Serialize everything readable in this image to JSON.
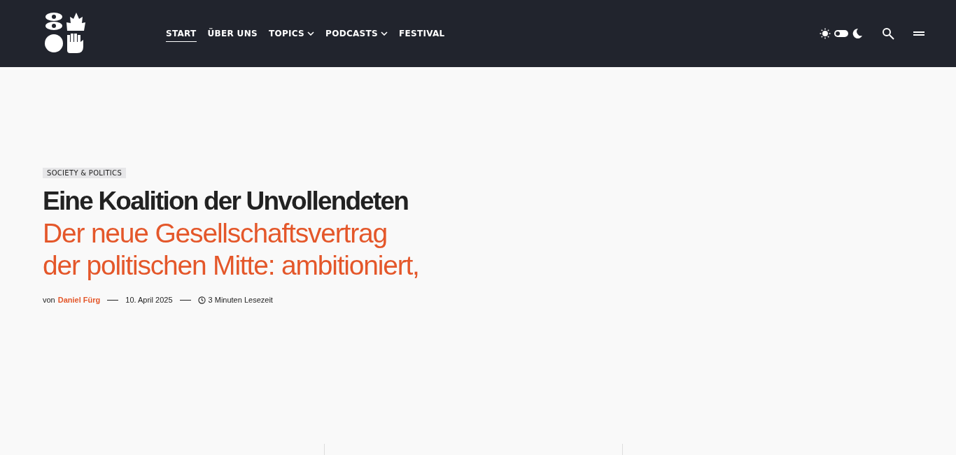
{
  "header": {
    "nav": [
      {
        "label": "START",
        "selected": true,
        "dropdown": false
      },
      {
        "label": "ÜBER UNS",
        "selected": false,
        "dropdown": false
      },
      {
        "label": "TOPICS",
        "selected": false,
        "dropdown": true
      },
      {
        "label": "PODCASTS",
        "selected": false,
        "dropdown": true
      },
      {
        "label": "FESTIVAL",
        "selected": false,
        "dropdown": false
      }
    ],
    "dark_mode": false
  },
  "article": {
    "category": "SOCIETY & POLITICS",
    "title": "Eine Koalition der Unvollendeten",
    "subtitle_lines": [
      "Der neue Gesellschaftsvertrag",
      "der politischen Mitte: ambitioniert,"
    ],
    "by": "von",
    "author": "Daniel Fürg",
    "date": "10. April 2025",
    "reading_time": "3 Minuten Lesezeit"
  }
}
